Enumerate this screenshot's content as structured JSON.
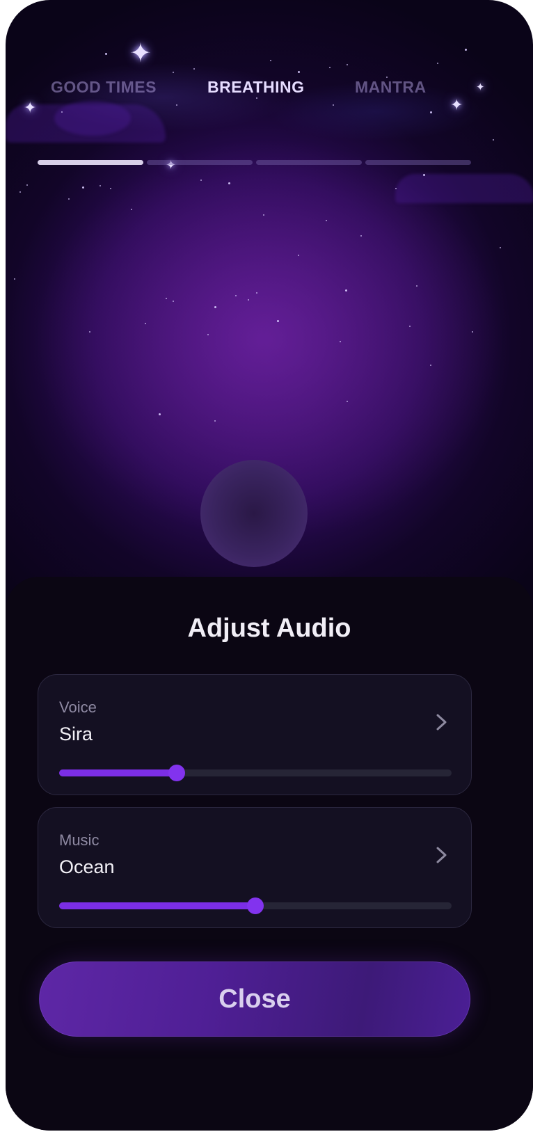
{
  "tabs": [
    {
      "label": "GOOD TIMES",
      "active": false
    },
    {
      "label": "BREATHING",
      "active": true
    },
    {
      "label": "MANTRA",
      "active": false
    }
  ],
  "progress": {
    "segments": 4,
    "completed_fraction_of_first": 1.0
  },
  "sheet": {
    "title": "Adjust Audio",
    "voice": {
      "label": "Voice",
      "value": "Sira",
      "level": 0.3
    },
    "music": {
      "label": "Music",
      "value": "Ocean",
      "level": 0.5
    },
    "close_label": "Close"
  },
  "colors": {
    "accent": "#7b2ee6",
    "sheet_bg": "#0b0613",
    "card_bg": "#141022",
    "button_bg": "#5e27a6"
  },
  "icons": {
    "chevron": "chevron-right-icon",
    "sparkle": "sparkle-star-icon"
  }
}
